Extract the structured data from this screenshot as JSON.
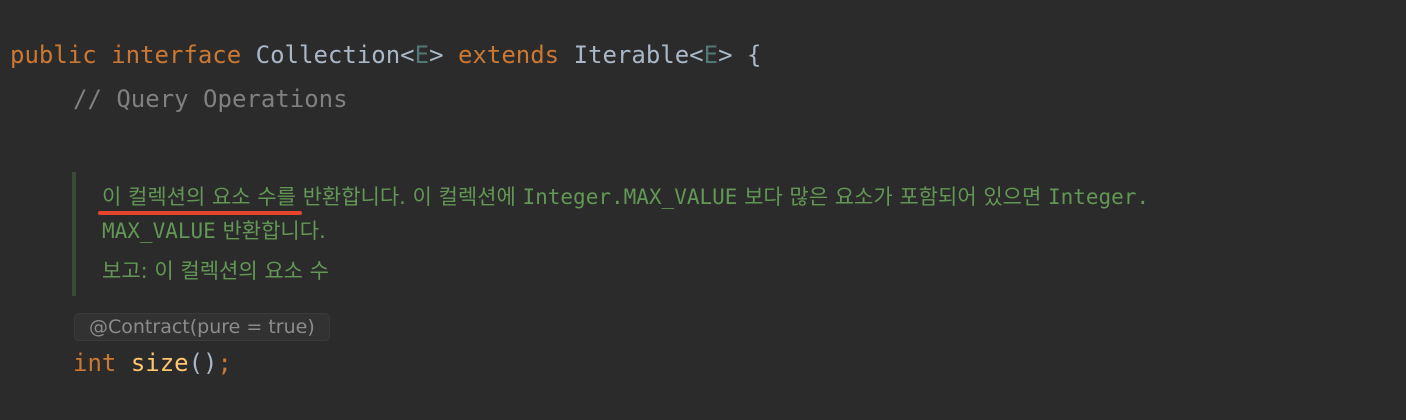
{
  "code": {
    "line1": {
      "kw_public": "public",
      "kw_interface": "interface",
      "type_name": "Collection",
      "lt1": "<",
      "generic1": "E",
      "gt1": ">",
      "kw_extends": "extends",
      "parent_type": "Iterable",
      "lt2": "<",
      "generic2": "E",
      "gt2": ">",
      "open_brace": "{"
    },
    "comment": "// Query Operations",
    "doc": {
      "line1_part1": "이 컬렉션의 요소 수를 반환합니다. 이 컬렉션에 ",
      "line1_mono1": "Integer.MAX_VALUE",
      "line1_part2": " 보다 많은 요소가 포함되어 있으면 ",
      "line1_mono2": "Integer.",
      "line2_mono": "MAX_VALUE",
      "line2_part": " 반환합니다.",
      "returns_line": "보고: 이 컬렉션의 요소 수"
    },
    "annotation_hint": "@Contract(pure = true)",
    "method_line": {
      "return_type": "int",
      "method_name": "size",
      "parens": "()",
      "semicolon": ";"
    }
  },
  "colors": {
    "background": "#2b2b2b",
    "keyword": "#cc7832",
    "doc_text": "#629755",
    "comment": "#808080",
    "method": "#ffc66d",
    "underline_mark": "#e5452b"
  }
}
